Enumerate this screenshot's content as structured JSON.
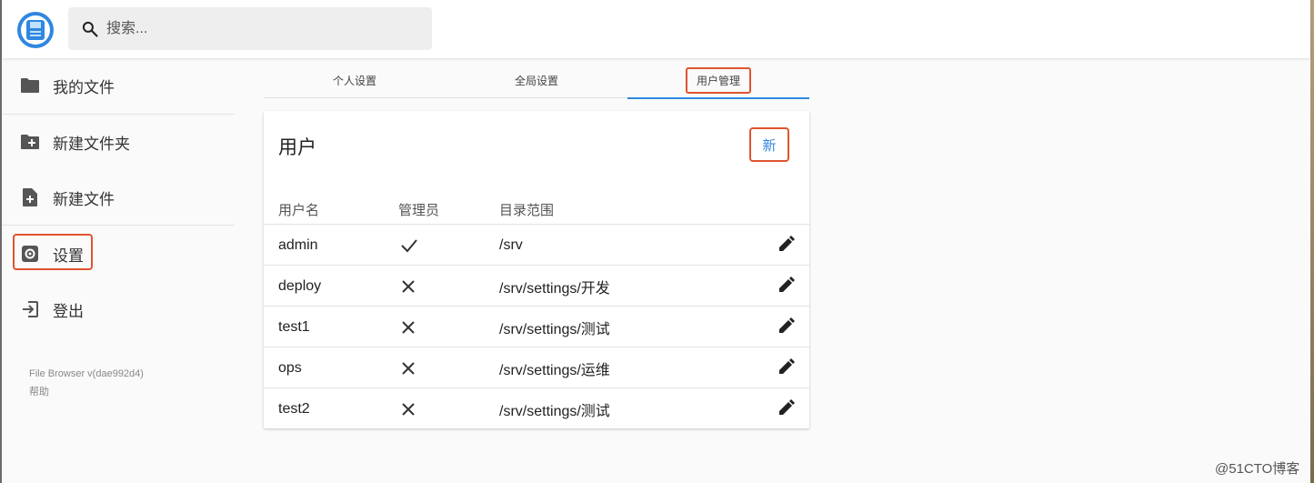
{
  "header": {
    "search_placeholder": "搜索..."
  },
  "sidebar": {
    "items": [
      {
        "label": "我的文件",
        "icon": "folder-icon"
      },
      {
        "label": "新建文件夹",
        "icon": "new-folder-icon"
      },
      {
        "label": "新建文件",
        "icon": "new-file-icon"
      },
      {
        "label": "设置",
        "icon": "settings-icon"
      },
      {
        "label": "登出",
        "icon": "logout-icon"
      }
    ],
    "version": "File Browser v(dae992d4)",
    "help": "帮助"
  },
  "tabs": [
    {
      "label": "个人设置",
      "active": false
    },
    {
      "label": "全局设置",
      "active": false
    },
    {
      "label": "用户管理",
      "active": true
    }
  ],
  "users_card": {
    "title": "用户",
    "new_label": "新",
    "columns": [
      "用户名",
      "管理员",
      "目录范围"
    ],
    "rows": [
      {
        "username": "admin",
        "admin": true,
        "scope": "/srv"
      },
      {
        "username": "deploy",
        "admin": false,
        "scope": "/srv/settings/开发"
      },
      {
        "username": "test1",
        "admin": false,
        "scope": "/srv/settings/测试"
      },
      {
        "username": "ops",
        "admin": false,
        "scope": "/srv/settings/运维"
      },
      {
        "username": "test2",
        "admin": false,
        "scope": "/srv/settings/测试"
      }
    ]
  },
  "colors": {
    "accent": "#2f87e0",
    "highlight": "#e0542e"
  },
  "watermark": "@51CTO博客"
}
